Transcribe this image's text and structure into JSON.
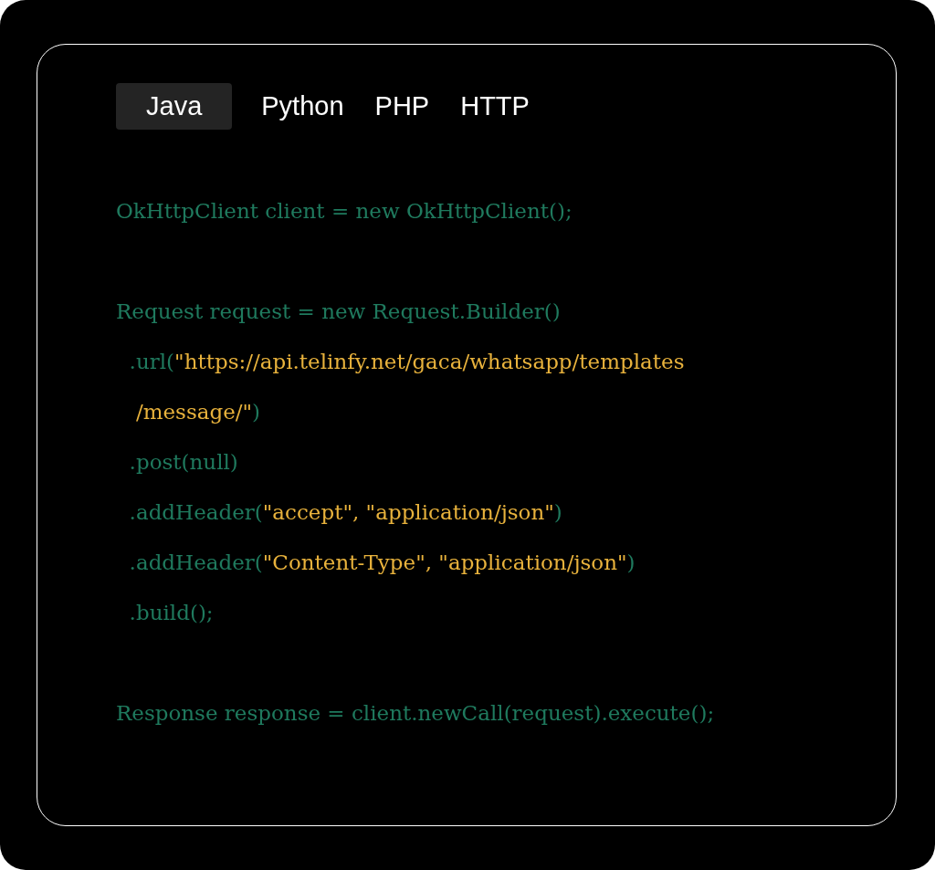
{
  "tabs": [
    {
      "label": "Java",
      "selected": true
    },
    {
      "label": "Python",
      "selected": false
    },
    {
      "label": "PHP",
      "selected": false
    },
    {
      "label": "HTTP",
      "selected": false
    }
  ],
  "code_blocks": [
    {
      "lines": [
        [
          {
            "kind": "code",
            "text": "OkHttpClient client = new OkHttpClient();"
          }
        ]
      ]
    },
    {
      "lines": [
        [
          {
            "kind": "code",
            "text": "Request request = new Request.Builder()"
          }
        ],
        [
          {
            "kind": "code",
            "text": "  .url("
          },
          {
            "kind": "string",
            "text": "\"https://api.telinfy.net/gaca/whatsapp/templates"
          }
        ],
        [
          {
            "kind": "string",
            "text": "   /message/\""
          },
          {
            "kind": "code",
            "text": ")"
          }
        ],
        [
          {
            "kind": "code",
            "text": "  .post(null)"
          }
        ],
        [
          {
            "kind": "code",
            "text": "  .addHeader("
          },
          {
            "kind": "string",
            "text": "\"accept\", \"application/json\""
          },
          {
            "kind": "code",
            "text": ")"
          }
        ],
        [
          {
            "kind": "code",
            "text": "  .addHeader("
          },
          {
            "kind": "string",
            "text": "\"Content-Type\", \"application/json\""
          },
          {
            "kind": "code",
            "text": ")"
          }
        ],
        [
          {
            "kind": "code",
            "text": "  .build();"
          }
        ]
      ]
    },
    {
      "lines": [
        [
          {
            "kind": "code",
            "text": "Response response = client.newCall(request).execute();"
          }
        ]
      ]
    }
  ]
}
